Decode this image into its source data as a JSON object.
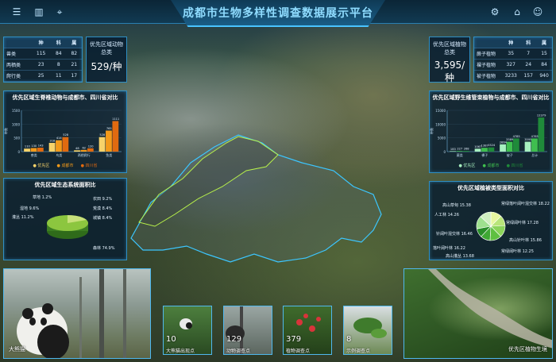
{
  "header": {
    "title": "成都市生物多样性调查数据展示平台",
    "left_icons": [
      "list-icon",
      "chart-icon",
      "map-pin-icon"
    ],
    "right_icons": [
      "gear-icon",
      "home-icon",
      "user-icon"
    ]
  },
  "animal_table": {
    "headers": [
      "",
      "种",
      "科",
      "属"
    ],
    "rows": [
      [
        "兽类",
        "115",
        "84",
        "82"
      ],
      [
        "两栖类",
        "23",
        "8",
        "21"
      ],
      [
        "爬行类",
        "25",
        "11",
        "17"
      ]
    ]
  },
  "animal_total": {
    "label": "优先区域动物总类",
    "value": "529/种"
  },
  "plant_table": {
    "headers": [
      "",
      "种",
      "科",
      "属"
    ],
    "rows": [
      [
        "蕨子植物",
        "35",
        "7",
        "15"
      ],
      [
        "裸子植物",
        "327",
        "24",
        "84"
      ],
      [
        "被子植物",
        "3233",
        "157",
        "940"
      ]
    ]
  },
  "plant_total": {
    "label": "优先区域植物总类",
    "value": "3,595/种"
  },
  "animal_chart": {
    "title": "优先区域生脊椎动物与成都市、四川省对比",
    "ylabel": "种数",
    "legend": [
      "优先区",
      "成都市",
      "四川省"
    ]
  },
  "plant_chart": {
    "title": "优先区域野生维管束植物与成都市、四川省对比",
    "ylabel": "种数",
    "legend": [
      "优先区",
      "成都市",
      "四川省"
    ]
  },
  "eco_chart": {
    "title": "优先区域生态系统面积比",
    "labels": [
      "草地 1.2%",
      "湿地 9.6%",
      "灌丛 11.2%",
      "农田 9.2%",
      "荒漠 8.4%",
      "城镇 8.4%",
      "森林 74.9%"
    ]
  },
  "veg_chart": {
    "title": "优先区域植被类型面积对比",
    "labels": [
      "高山草甸 15.38",
      "人工林 14.26",
      "针阔叶混交林 16.46",
      "落叶阔叶林 16.22",
      "高山灌丛 13.68",
      "常绿阔叶林 12.25",
      "常绿落叶阔叶混交林 18.22",
      "常绿阔叶林 17.28",
      "高山针叶林 15.86"
    ]
  },
  "photos": {
    "main_left_caption": "大熊猫",
    "main_right_caption": "优先区植物生境",
    "thumbs": [
      {
        "count": "10",
        "caption": "大熊猫出现点"
      },
      {
        "count": "129",
        "caption": "动物调查点"
      },
      {
        "count": "379",
        "caption": "植物调查点"
      },
      {
        "count": "8",
        "caption": "示例调查点"
      }
    ]
  },
  "chart_data": [
    {
      "type": "bar",
      "title": "优先区域生脊椎动物与成都市、四川省对比",
      "ylabel": "种数",
      "ylim": [
        0,
        1500
      ],
      "categories": [
        "兽类",
        "鸟类",
        "两栖爬行",
        "鱼类"
      ],
      "series": [
        {
          "name": "优先区",
          "values": [
            110,
            318,
            48,
            528
          ]
        },
        {
          "name": "成都市",
          "values": [
            130,
            414,
            62,
            765
          ]
        },
        {
          "name": "四川省",
          "values": [
            143,
            528,
            120,
            1111
          ]
        }
      ]
    },
    {
      "type": "bar",
      "title": "优先区域野生维管束植物与成都市、四川省对比",
      "ylabel": "种数",
      "ylim": [
        0,
        15000
      ],
      "categories": [
        "蕨类",
        "裸子",
        "被子",
        "总计"
      ],
      "series": [
        {
          "name": "优先区",
          "values": [
            183,
            1067,
            2664,
            3595
          ]
        },
        {
          "name": "成都市",
          "values": [
            227,
            1387,
            3589,
            4785
          ]
        },
        {
          "name": "四川省",
          "values": [
            268,
            1524,
            4785,
            12379
          ]
        }
      ]
    },
    {
      "type": "pie",
      "title": "优先区域生态系统面积比",
      "categories": [
        "森林",
        "灌丛",
        "湿地",
        "草地",
        "农田",
        "荒漠",
        "城镇"
      ],
      "values": [
        74.9,
        11.2,
        9.6,
        1.2,
        9.2,
        8.4,
        8.4
      ]
    },
    {
      "type": "pie",
      "title": "优先区域植被类型面积对比",
      "categories": [
        "高山草甸",
        "人工林",
        "针阔叶混交林",
        "落叶阔叶林",
        "高山灌丛",
        "常绿阔叶林",
        "常绿落叶阔叶混交林",
        "高山针叶林"
      ],
      "values": [
        15.38,
        14.26,
        16.46,
        16.22,
        13.68,
        12.25,
        18.22,
        15.86
      ]
    }
  ],
  "colors": {
    "accent": "#49c3ff",
    "panel_border": "#2f8fc4",
    "orange": "#f39a1a",
    "green": "#3fbf4f"
  }
}
